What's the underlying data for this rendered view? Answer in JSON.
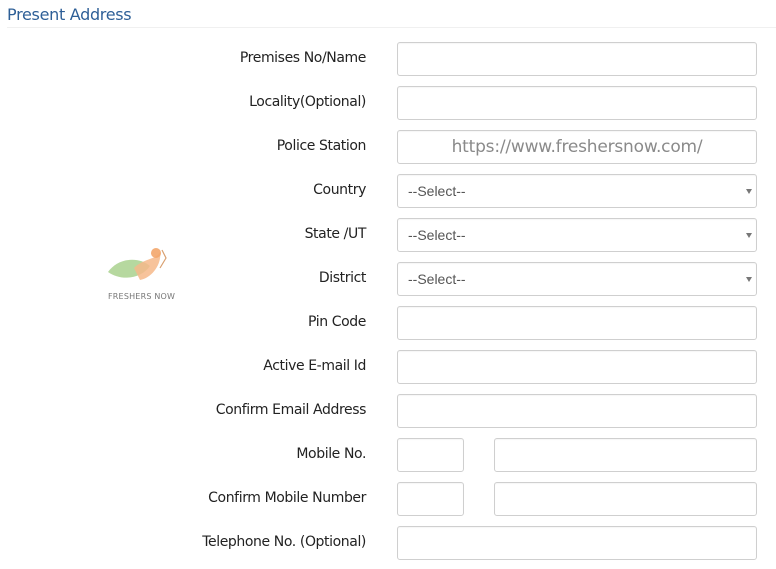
{
  "section": {
    "title": "Present Address"
  },
  "watermark": {
    "logo_text": "FRESHERS NOW"
  },
  "fields": [
    {
      "label": "Premises No/Name",
      "type": "text",
      "value": ""
    },
    {
      "label": "Locality(Optional)",
      "type": "text",
      "value": ""
    },
    {
      "label": "Police Station",
      "type": "text",
      "value": "https://www.freshersnow.com/"
    },
    {
      "label": "Country",
      "type": "select",
      "value": "--Select--"
    },
    {
      "label": "State /UT",
      "type": "select",
      "value": "--Select--"
    },
    {
      "label": "District",
      "type": "select",
      "value": "--Select--"
    },
    {
      "label": "Pin Code",
      "type": "text",
      "value": ""
    },
    {
      "label": "Active E-mail Id",
      "type": "text",
      "value": ""
    },
    {
      "label": "Confirm Email Address",
      "type": "text",
      "value": ""
    },
    {
      "label": "Mobile No.",
      "type": "split",
      "code": "",
      "value": ""
    },
    {
      "label": "Confirm Mobile Number",
      "type": "split",
      "code": "",
      "value": ""
    },
    {
      "label": "Telephone No. (Optional)",
      "type": "text",
      "value": ""
    }
  ],
  "colors": {
    "heading": "#2e5f97",
    "border": "#cfcfcf"
  }
}
